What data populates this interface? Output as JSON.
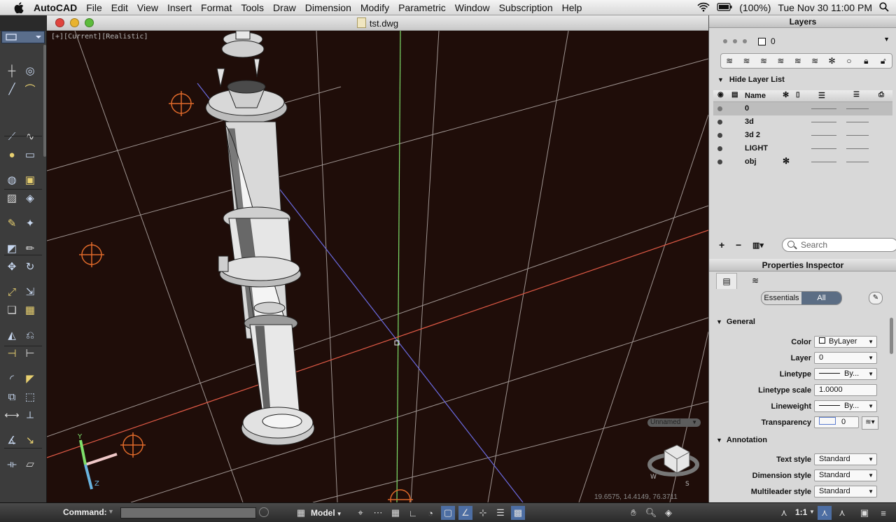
{
  "menubar": {
    "app": "AutoCAD",
    "items": [
      "File",
      "Edit",
      "View",
      "Insert",
      "Format",
      "Tools",
      "Draw",
      "Dimension",
      "Modify",
      "Parametric",
      "Window",
      "Subscription",
      "Help"
    ],
    "battery": "(100%)",
    "clock": "Tue Nov 30  11:00 PM"
  },
  "window": {
    "title": "tst.dwg",
    "light_colors": [
      "#e0443e",
      "#e9b32e",
      "#5dbb3b"
    ]
  },
  "viewport": {
    "label": "[+][Current][Realistic]",
    "view_name": "Unnamed",
    "coords": "19.6575, 14.4149, 76.3711",
    "background": "#1f0d09",
    "axis_colors": {
      "x": "#e05a46",
      "y": "#7fe06a",
      "z": "#6a6ae0"
    }
  },
  "layers_panel": {
    "title": "Layers",
    "current_layer": "0",
    "hide_list_label": "Hide Layer List",
    "header_name": "Name",
    "rows": [
      {
        "name": "0",
        "frozen": false,
        "selected": true
      },
      {
        "name": "3d",
        "frozen": false,
        "selected": false
      },
      {
        "name": "3d 2",
        "frozen": false,
        "selected": false
      },
      {
        "name": "LIGHT",
        "frozen": false,
        "selected": false
      },
      {
        "name": "obj",
        "frozen": true,
        "selected": false
      }
    ],
    "add": "+",
    "remove": "−",
    "search_placeholder": "Search"
  },
  "properties": {
    "title": "Properties Inspector",
    "seg_essentials": "Essentials",
    "seg_all": "All",
    "general": "General",
    "annotation": "Annotation",
    "rows": [
      {
        "label": "Color",
        "value": "ByLayer"
      },
      {
        "label": "Layer",
        "value": "0"
      },
      {
        "label": "Linetype",
        "value": "By..."
      },
      {
        "label": "Linetype scale",
        "value": "1.0000"
      },
      {
        "label": "Lineweight",
        "value": "By..."
      },
      {
        "label": "Transparency",
        "value": "0"
      }
    ],
    "annotation_rows": [
      {
        "label": "Text style",
        "value": "Standard"
      },
      {
        "label": "Dimension style",
        "value": "Standard"
      },
      {
        "label": "Multileader style",
        "value": "Standard"
      }
    ]
  },
  "statusbar": {
    "command_label": "Command:",
    "model": "Model",
    "scale": "1:1"
  }
}
